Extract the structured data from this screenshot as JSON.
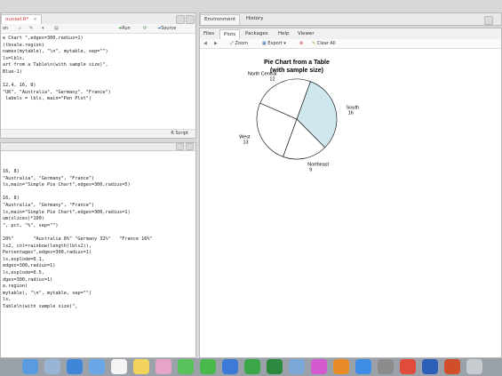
{
  "editor": {
    "tab_label": "ounsel.R*",
    "toolbar": {
      "source_on_save": "on",
      "run_label": "Run",
      "source_label": "Source"
    },
    "lines": [
      "e Chart \",edges=300,radius=1)",
      "(tbsale.region)",
      "names(mytable), \"\\n\", mytable, sep=\"\")",
      "ls=lbls,",
      "art from a Table\\n(with sample size)\",",
      "Blue-1)",
      "",
      "12,4, 16, 8)",
      "\"UK\", \"Australia\", \"Germany\", \"France\")",
      " labels = lbls, main=\"Pen Plot\")"
    ],
    "status": "R Script"
  },
  "console": {
    "lines": [
      "16, 8)",
      "\"Australia\", \"Germany\", \"France\")",
      "ls,main=\"Simple Pie Chart\",edges=300,radius=5)",
      "",
      "16, 8)",
      "\"Australia\", \"Germany\", \"France\")",
      "ls,main=\"Simple Pie Chart\",edges=300,radius=1)",
      "um(slices)*100)",
      "\", pct, \"%\", sep=\"\")",
      "",
      "20%\"       \"Australia 8%\" \"Germany 32%\"   \"France 16%\"",
      "ls2, col=rainbow(length(lbls2)),",
      "Percentages\",edges=300,radius=1)",
      "ls,explode=0.1,",
      "edges=300,radius=1)",
      "ls,explode=0.5,",
      "dges=300,radius=1)",
      "e.region)",
      "mytable), \"\\n\", mytable, sep=\"\")",
      "ls,",
      "Table\\n(with sample size)\","
    ]
  },
  "env": {
    "tabs": [
      "Environment",
      "History"
    ]
  },
  "viewer": {
    "tabs": [
      "Files",
      "Plots",
      "Packages",
      "Help",
      "Viewer"
    ],
    "toolbar": {
      "zoom_label": "Zoom",
      "export_label": "Export",
      "clear_label": "Clear All"
    }
  },
  "chart_data": {
    "type": "pie",
    "title": "Pie Chart from a Table",
    "subtitle": "(with sample size)",
    "slices": [
      {
        "label": "South",
        "value": 16,
        "fill": "#cfe7ef"
      },
      {
        "label": "Northeast",
        "value": 9,
        "fill": "#ffffff"
      },
      {
        "label": "West",
        "value": 13,
        "fill": "#ffffff"
      },
      {
        "label": "North Central",
        "value": 12,
        "fill": "#ffffff"
      }
    ]
  },
  "dock": {
    "icons": [
      {
        "name": "finder-icon",
        "color": "#5a9be0"
      },
      {
        "name": "launchpad-icon",
        "color": "#9ab4d6"
      },
      {
        "name": "safari-icon",
        "color": "#3f86d8"
      },
      {
        "name": "mail-icon",
        "color": "#6aa7e6"
      },
      {
        "name": "calendar-icon",
        "color": "#f4f4f4"
      },
      {
        "name": "notes-icon",
        "color": "#f2d45c"
      },
      {
        "name": "photos-icon",
        "color": "#e8a4c8"
      },
      {
        "name": "messages-icon",
        "color": "#58c15a"
      },
      {
        "name": "facetime-icon",
        "color": "#49b94b"
      },
      {
        "name": "keynote-icon",
        "color": "#3b7ad8"
      },
      {
        "name": "numbers-icon",
        "color": "#3ca64a"
      },
      {
        "name": "excel-icon",
        "color": "#2b8a3e"
      },
      {
        "name": "rstudio-icon",
        "color": "#7aa7d6"
      },
      {
        "name": "itunes-icon",
        "color": "#d45ad0"
      },
      {
        "name": "books-icon",
        "color": "#e88c2a"
      },
      {
        "name": "appstore-icon",
        "color": "#3f8ee6"
      },
      {
        "name": "preferences-icon",
        "color": "#8c8c8c"
      },
      {
        "name": "chrome-icon",
        "color": "#e04b3c"
      },
      {
        "name": "word-icon",
        "color": "#2d5fb8"
      },
      {
        "name": "powerpoint-icon",
        "color": "#d14e2a"
      },
      {
        "name": "trash-icon",
        "color": "#c6cbd0"
      }
    ]
  }
}
